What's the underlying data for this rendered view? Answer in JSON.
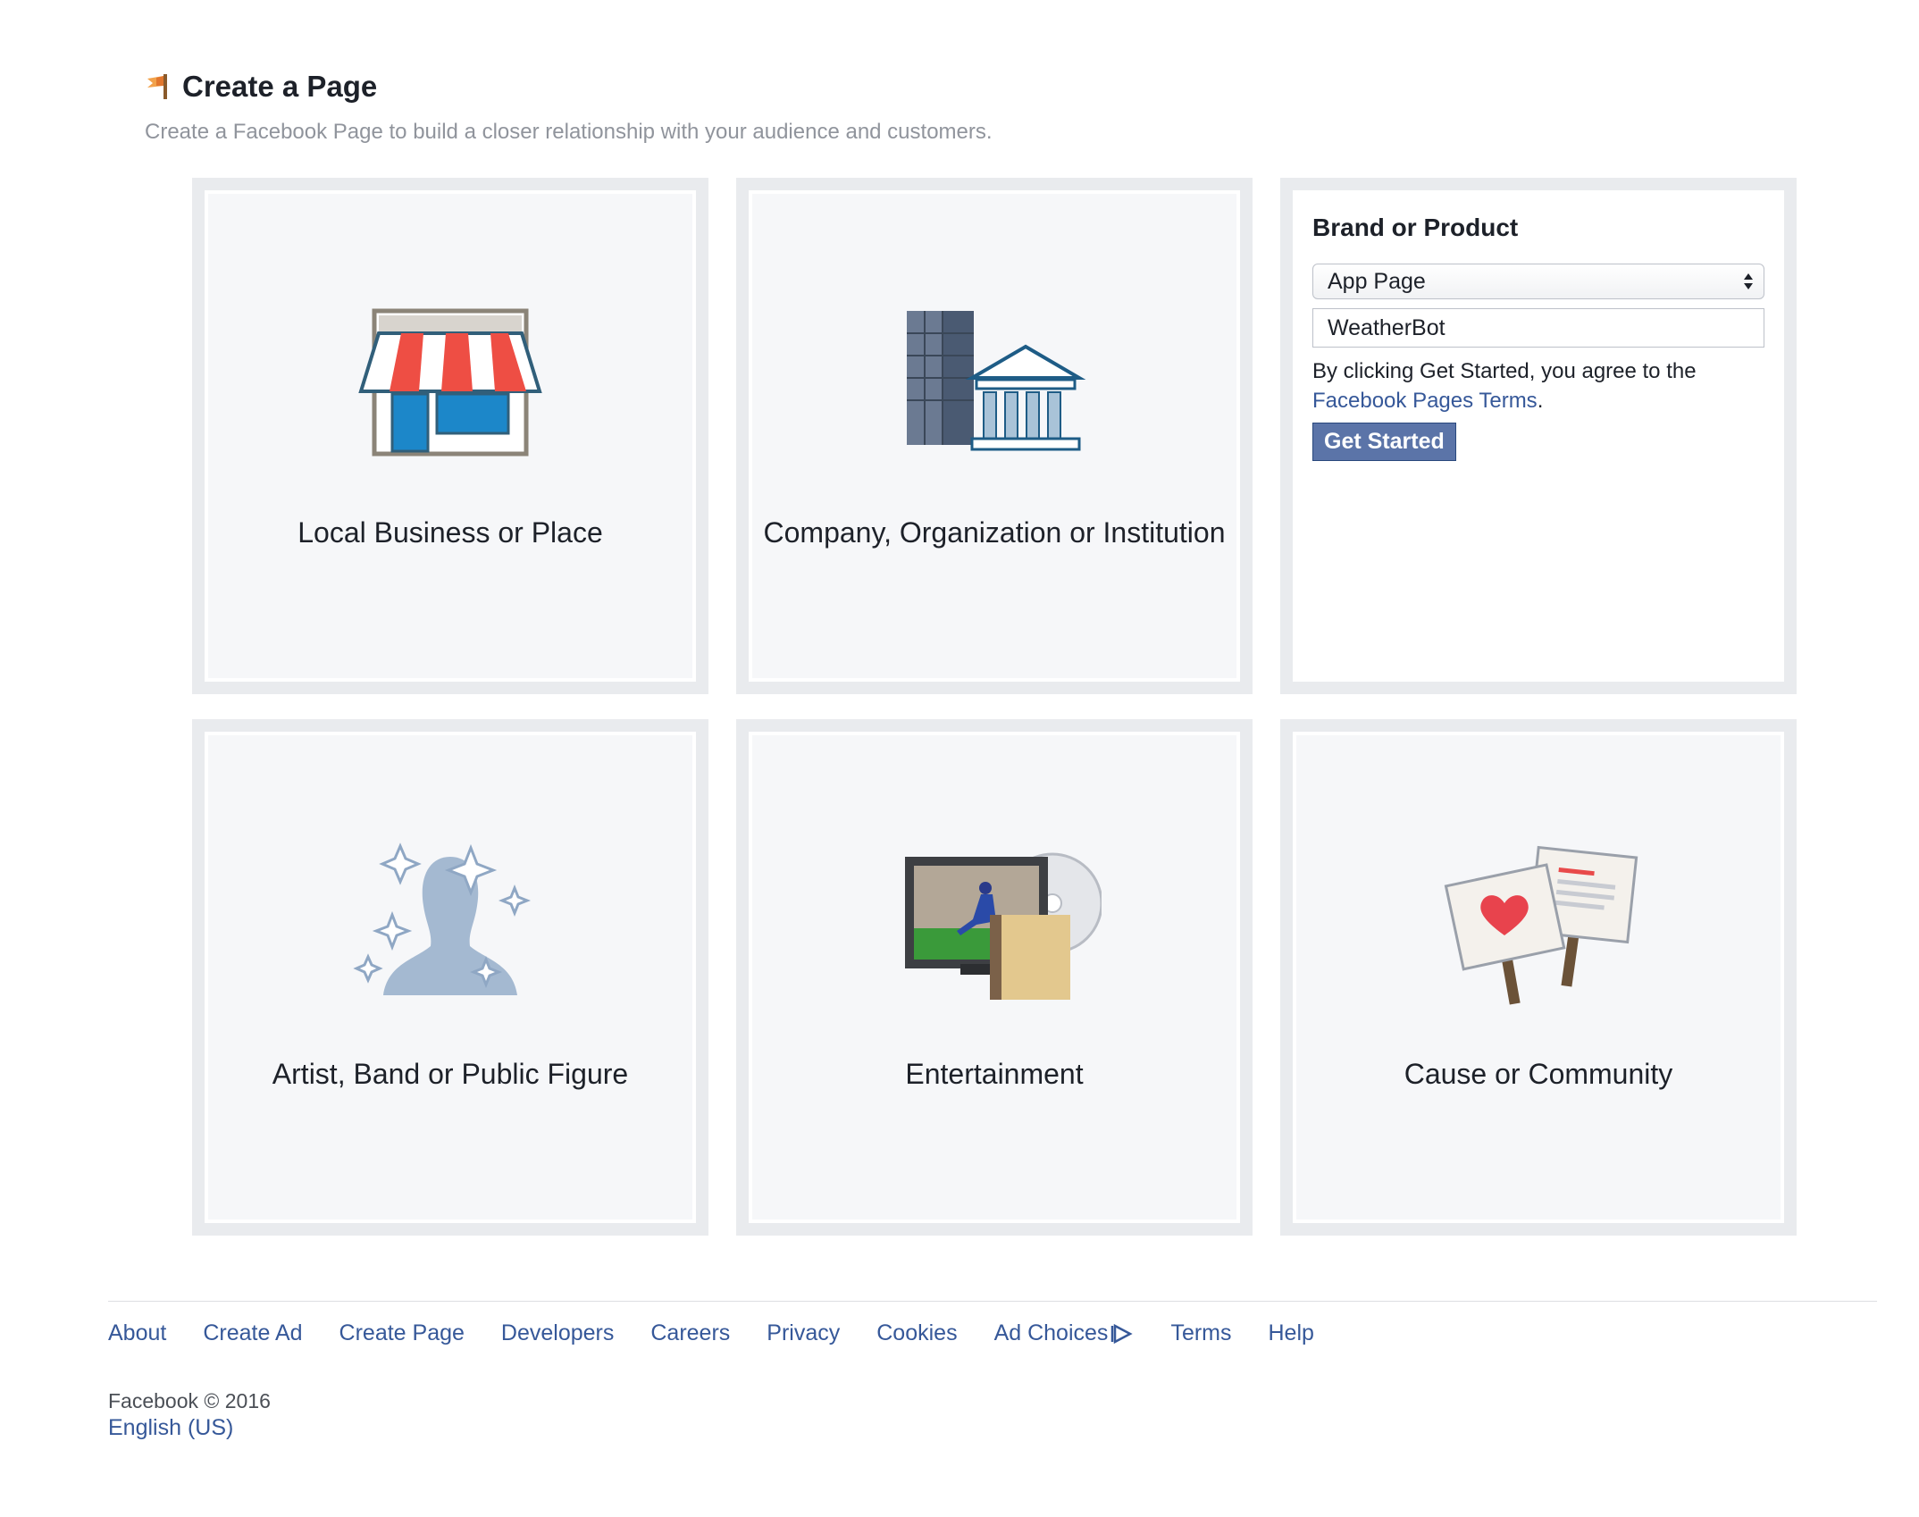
{
  "header": {
    "title": "Create a Page",
    "subtitle": "Create a Facebook Page to build a closer relationship with your audience and customers.",
    "icon": "flag-icon"
  },
  "categories": [
    {
      "label": "Local Business or Place",
      "icon": "storefront-icon"
    },
    {
      "label": "Company, Organization or Institution",
      "icon": "buildings-icon"
    },
    {
      "label": "Artist, Band or Public Figure",
      "icon": "silhouette-icon"
    },
    {
      "label": "Entertainment",
      "icon": "media-icon"
    },
    {
      "label": "Cause or Community",
      "icon": "signs-icon"
    }
  ],
  "brand_form": {
    "title": "Brand or Product",
    "category_selected": "App Page",
    "name_value": "WeatherBot",
    "agree_text": "By clicking Get Started, you agree to the",
    "terms_link": "Facebook Pages Terms",
    "terms_suffix": ".",
    "button_label": "Get Started"
  },
  "footer": {
    "links": [
      "About",
      "Create Ad",
      "Create Page",
      "Developers",
      "Careers",
      "Privacy",
      "Cookies",
      "Ad Choices",
      "Terms",
      "Help"
    ],
    "copyright": "Facebook © 2016",
    "language": "English (US)"
  },
  "colors": {
    "link": "#365899",
    "button": "#5b74a8",
    "tile_border": "#e9ebee",
    "tile_bg": "#f6f7f9"
  }
}
